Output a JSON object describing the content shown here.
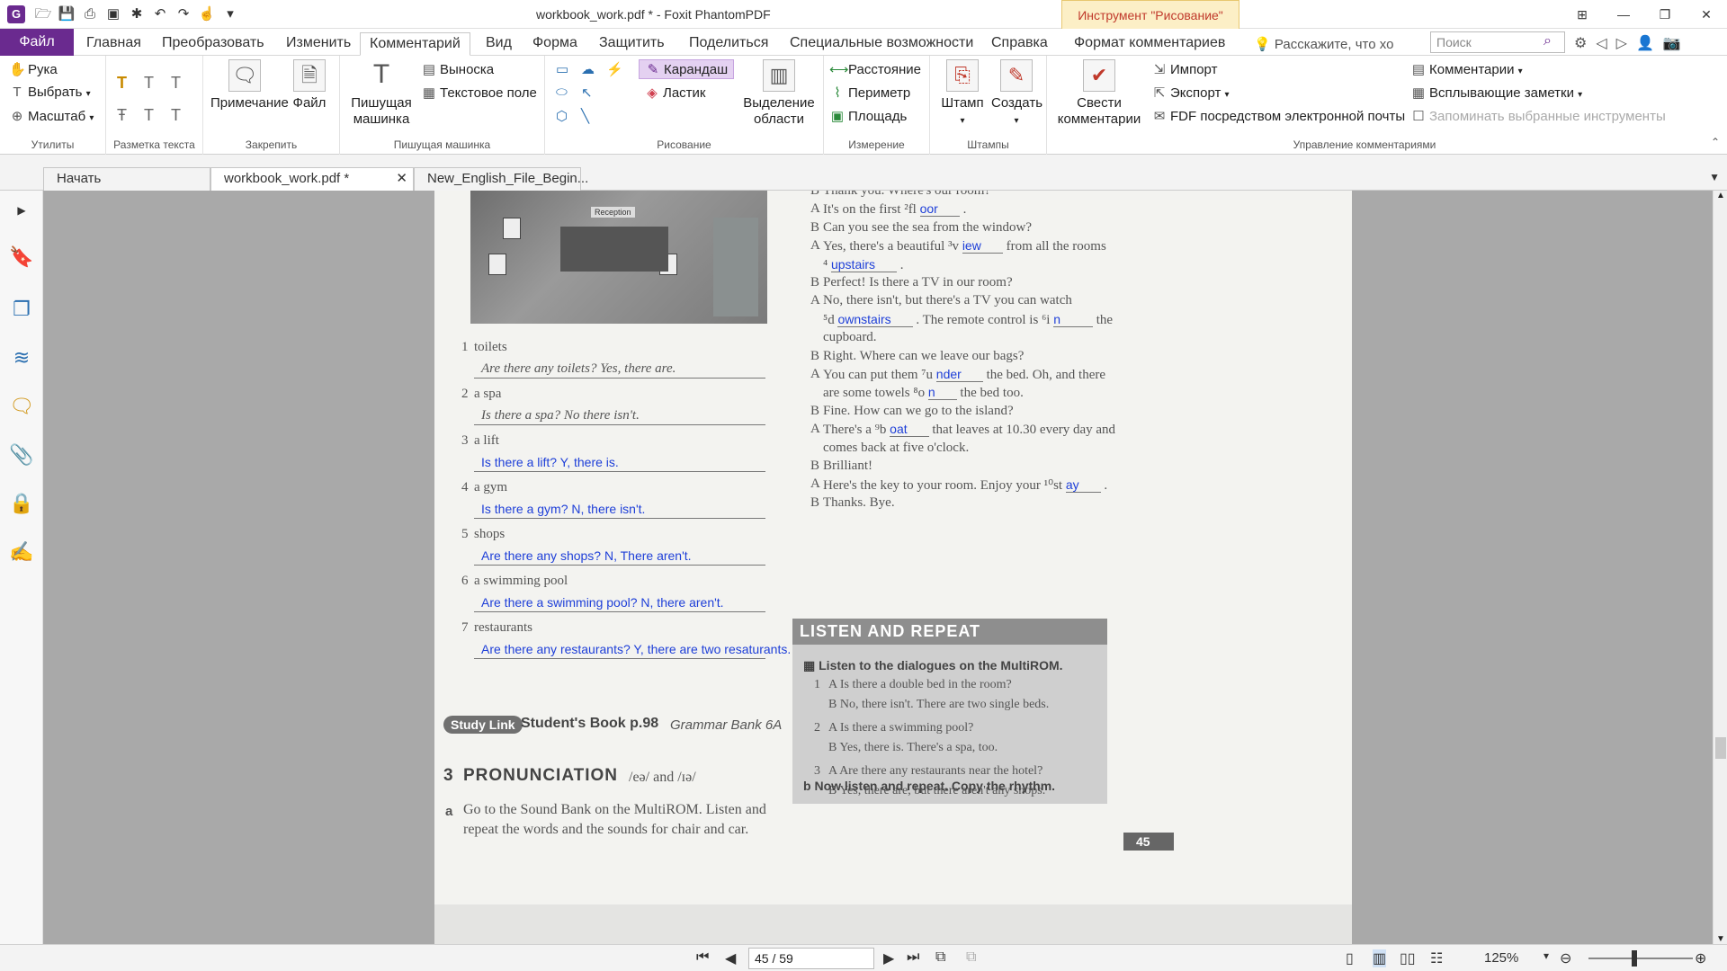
{
  "window": {
    "title": "workbook_work.pdf * - Foxit PhantomPDF",
    "context_tab": "Инструмент \"Рисование\""
  },
  "menu": {
    "file": "Файл",
    "tabs": [
      "Главная",
      "Преобразовать",
      "Изменить",
      "Комментарий",
      "Вид",
      "Форма",
      "Защитить",
      "Поделиться",
      "Специальные возможности",
      "Справка",
      "Формат комментариев"
    ],
    "tell_me": "Расскажите, что хо",
    "search_placeholder": "Поиск"
  },
  "ribbon": {
    "utilities": {
      "label": "Утилиты",
      "hand": "Рука",
      "select": "Выбрать",
      "zoom": "Масштаб"
    },
    "text_markup": {
      "label": "Разметка текста"
    },
    "pin": {
      "label": "Закрепить",
      "note": "Примечание",
      "file": "Файл"
    },
    "typewriter": {
      "label": "Пишущая машинка",
      "typewriter": "Пишущая машинка",
      "callout": "Выноска",
      "textbox": "Текстовое поле"
    },
    "drawing": {
      "label": "Рисование",
      "pencil": "Карандаш",
      "eraser": "Ластик",
      "area_highlight": "Выделение области"
    },
    "measure": {
      "label": "Измерение",
      "distance": "Расстояние",
      "perimeter": "Периметр",
      "area": "Площадь"
    },
    "stamps": {
      "label": "Штампы",
      "stamp": "Штамп",
      "create": "Создать"
    },
    "manage": {
      "label": "Управление комментариями",
      "summarize": "Свести комментарии",
      "import": "Импорт",
      "export": "Экспорт",
      "fdf_email": "FDF посредством электронной почты",
      "comments": "Комментарии",
      "popup_notes": "Всплывающие заметки",
      "remember": "Запоминать выбранные инструменты"
    }
  },
  "doc_tabs": [
    "Начать",
    "workbook_work.pdf *",
    "New_English_File_Begin..."
  ],
  "status": {
    "page": "45 / 59",
    "zoom": "125%"
  },
  "pdf": {
    "image_label": "Reception",
    "left_items": [
      {
        "n": "1",
        "word": "toilets",
        "answer": "Are there any toilets? Yes, there are.",
        "typed": false
      },
      {
        "n": "2",
        "word": "a spa",
        "answer": "Is there a spa? No there isn't.",
        "typed": false
      },
      {
        "n": "3",
        "word": "a lift",
        "answer": "Is there a lift? Y, there is.",
        "typed": true
      },
      {
        "n": "4",
        "word": "a gym",
        "answer": "Is there a gym? N, there isn't.",
        "typed": true
      },
      {
        "n": "5",
        "word": "shops",
        "answer": "Are there any shops? N, There aren't.",
        "typed": true
      },
      {
        "n": "6",
        "word": "a swimming pool",
        "answer": "Are there a swimming pool? N, there aren't.",
        "typed": true
      },
      {
        "n": "7",
        "word": "restaurants",
        "answer": "Are there any restaurants? Y, there are two resaturants.",
        "typed": true
      }
    ],
    "study_link": {
      "badge": "Study Link",
      "book": "Student's Book p.98",
      "grammar": "Grammar Bank 6A"
    },
    "pronunciation": {
      "num": "3",
      "title": "PRONUNCIATION",
      "sounds": "/eə/ and /ɪə/",
      "a": "a",
      "instr1": "Go to the Sound Bank on the MultiROM. Listen and",
      "instr2": "repeat the words and the sounds for chair and car."
    },
    "dialogue": [
      {
        "s": "B",
        "t": "Thank you. Where's our room?"
      },
      {
        "s": "A",
        "t": "It's on the first ²fl",
        "a": "oor",
        "after": "."
      },
      {
        "s": "B",
        "t": "Can you see the sea from the window?"
      },
      {
        "s": "A",
        "t": "Yes, there's a beautiful ³v",
        "a": "iew",
        "after": "from all the rooms"
      },
      {
        "s": "",
        "t": "⁴",
        "a": "upstairs",
        "after": "."
      },
      {
        "s": "B",
        "t": "Perfect! Is there a TV in our room?"
      },
      {
        "s": "A",
        "t": "No, there isn't, but there's a TV you can watch"
      },
      {
        "s": "",
        "t": "⁵d",
        "a": "ownstairs",
        "after": ". The remote control is ⁶i",
        "a2": "n",
        "after2": "the"
      },
      {
        "s": "",
        "t": "cupboard."
      },
      {
        "s": "B",
        "t": "Right. Where can we leave our bags?"
      },
      {
        "s": "A",
        "t": "You can put them ⁷u",
        "a": "nder",
        "after": "the bed. Oh, and there"
      },
      {
        "s": "",
        "t": "are some towels ⁸o",
        "a": "n",
        "after": "the bed too."
      },
      {
        "s": "B",
        "t": "Fine. How can we go to the island?"
      },
      {
        "s": "A",
        "t": "There's a ⁹b",
        "a": "oat",
        "after": "that leaves at 10.30 every day and"
      },
      {
        "s": "",
        "t": "comes back at five o'clock."
      },
      {
        "s": "B",
        "t": "Brilliant!"
      },
      {
        "s": "A",
        "t": "Here's the key to your room. Enjoy your ¹⁰st",
        "a": "ay",
        "after": "."
      },
      {
        "s": "B",
        "t": "Thanks. Bye."
      }
    ],
    "listen": {
      "title": "LISTEN AND REPEAT",
      "instr": "Listen to the dialogues on the MultiROM.",
      "items": [
        {
          "n": "1",
          "a": "A  Is there a double bed in the room?",
          "b": "B  No, there isn't. There are two single beds."
        },
        {
          "n": "2",
          "a": "A  Is there a swimming pool?",
          "b": "B  Yes, there is. There's a spa, too."
        },
        {
          "n": "3",
          "a": "A  Are there any restaurants near the hotel?",
          "b": "B  Yes, there are, but there aren't any shops."
        }
      ],
      "b_label": "b",
      "now": "Now listen and repeat. Copy the rhythm."
    },
    "page_number": "45"
  }
}
